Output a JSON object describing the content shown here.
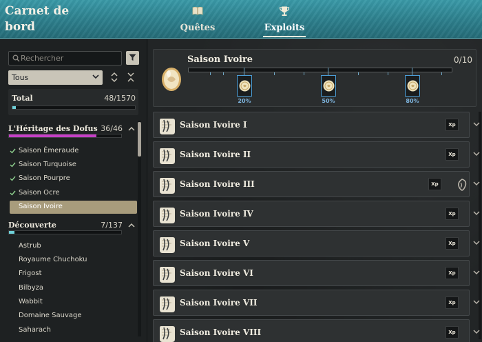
{
  "header": {
    "title": "Carnet de bord",
    "tabs": [
      {
        "label": "Quêtes",
        "icon": "book-icon",
        "active": false
      },
      {
        "label": "Exploits",
        "icon": "trophy-icon",
        "active": true
      }
    ],
    "accent_color": "#2d7f8c"
  },
  "sidebar": {
    "search_placeholder": "Rechercher",
    "filter_value": "Tous",
    "total": {
      "label": "Total",
      "count": "48/1570",
      "progress": 0.03
    },
    "categories": [
      {
        "name": "L'Héritage des Dofus",
        "count": "36/46",
        "progress": 0.78,
        "bar_color": "#c640c6",
        "expanded": true,
        "items": [
          {
            "label": "Saison Émeraude",
            "completed": true
          },
          {
            "label": "Saison Turquoise",
            "completed": true
          },
          {
            "label": "Saison Pourpre",
            "completed": true
          },
          {
            "label": "Saison Ocre",
            "completed": true
          },
          {
            "label": "Saison Ivoire",
            "completed": false,
            "selected": true
          }
        ]
      },
      {
        "name": "Découverte",
        "count": "7/137",
        "progress": 0.05,
        "bar_color": "#6fd0d8",
        "expanded": true,
        "items": [
          {
            "label": "Astrub"
          },
          {
            "label": "Royaume Chuchoku"
          },
          {
            "label": "Frigost"
          },
          {
            "label": "Bilbyza"
          },
          {
            "label": "Wabbit"
          },
          {
            "label": "Domaine Sauvage"
          },
          {
            "label": "Saharach"
          }
        ]
      }
    ]
  },
  "season": {
    "title": "Saison Ivoire",
    "count": "0/10",
    "progress": 0.0,
    "milestones": [
      "20%",
      "50%",
      "80%"
    ]
  },
  "achievements": [
    {
      "name": "Saison Ivoire I",
      "reward": "Xp",
      "bonus": false
    },
    {
      "name": "Saison Ivoire II",
      "reward": "Xp",
      "bonus": false
    },
    {
      "name": "Saison Ivoire III",
      "reward": "Xp",
      "bonus": true
    },
    {
      "name": "Saison Ivoire IV",
      "reward": "Xp",
      "bonus": false
    },
    {
      "name": "Saison Ivoire V",
      "reward": "Xp",
      "bonus": false
    },
    {
      "name": "Saison Ivoire VI",
      "reward": "Xp",
      "bonus": false
    },
    {
      "name": "Saison Ivoire VII",
      "reward": "Xp",
      "bonus": false
    },
    {
      "name": "Saison Ivoire VIII",
      "reward": "Xp",
      "bonus": false
    }
  ]
}
